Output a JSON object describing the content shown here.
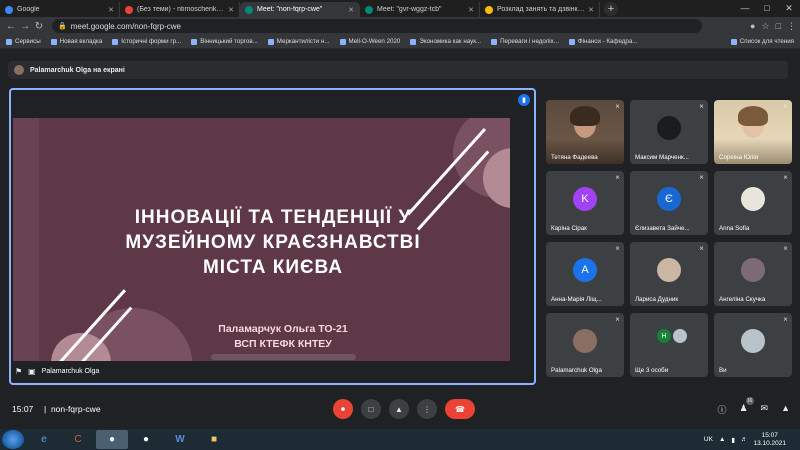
{
  "browser": {
    "tabs": [
      {
        "label": "Google",
        "color": "#4285f4"
      },
      {
        "label": "(Без теми) - ntimoschenkom@g",
        "color": "#ea4335"
      },
      {
        "label": "Meet: \"non-fqrp-cwe\"",
        "color": "#00897b",
        "active": true
      },
      {
        "label": "Meet: \"gvr-wggz-tcb\"",
        "color": "#00897b"
      },
      {
        "label": "Розклад занять та дзвінків | \"В",
        "color": "#fbbc05"
      }
    ],
    "url": "meet.google.com/non-fqrp-cwe",
    "bookmarks": [
      "Сервисы",
      "Новая вкладка",
      "Історичні форми гр...",
      "Вінницький торгов...",
      "Меркантилісти н...",
      "Mell-O-Ween 2020",
      "Экономика как наук...",
      "Переваги і недоліх...",
      "Фінанси - Кафедра..."
    ],
    "reading_list": "Список для чтения"
  },
  "meet": {
    "presenting_banner": "Palamarchuk Olga на екрані",
    "presenter_name": "Palamarchuk Olga",
    "slide": {
      "title_lines": [
        "ІННОВАЦІЇ ТА ТЕНДЕНЦІЇ У",
        "МУЗЕЙНОМУ КРАЄЗНАВСТВІ",
        "МІСТА КИЄВА"
      ],
      "author_lines": [
        "Паламарчук Ольга ТО-21",
        "ВСП КТЕФК КНТЕУ"
      ]
    },
    "participants": [
      {
        "name": "Тетяна Фадеева",
        "type": "camera",
        "cam": "tetiana"
      },
      {
        "name": "Максим Марченк...",
        "type": "avatar",
        "initial": "",
        "color": "#1b1b1b"
      },
      {
        "name": "Сореіна Юлія",
        "type": "camera",
        "cam": "soreina"
      },
      {
        "name": "Каріна Сірак",
        "type": "avatar",
        "initial": "K",
        "color": "#a142f4"
      },
      {
        "name": "Єлизавета Зайче...",
        "type": "avatar",
        "initial": "Є",
        "color": "#1967d2"
      },
      {
        "name": "Anna Sofia",
        "type": "avatar",
        "initial": "",
        "color": "#e9e4dc"
      },
      {
        "name": "Анна-Марія Ліщ...",
        "type": "avatar",
        "initial": "А",
        "color": "#1a73e8"
      },
      {
        "name": "Лариса Дудник",
        "type": "avatar",
        "initial": "",
        "color": "#c9b7a3"
      },
      {
        "name": "Ангеліна Скучка",
        "type": "avatar",
        "initial": "",
        "color": "#7d6a78"
      },
      {
        "name": "Palamarchuk Olga",
        "type": "avatar",
        "initial": "",
        "color": "#8a6e62"
      },
      {
        "name": "Ще 3 особи",
        "type": "multi",
        "initial": "Н"
      },
      {
        "name": "Ви",
        "type": "avatar",
        "initial": "",
        "color": "#b9c3c9"
      }
    ],
    "time": "15:07",
    "meeting_code": "non-fqrp-cwe",
    "people_count": "16"
  },
  "taskbar": {
    "lang": "UK",
    "time": "15:07",
    "date": "13.10.2021"
  }
}
